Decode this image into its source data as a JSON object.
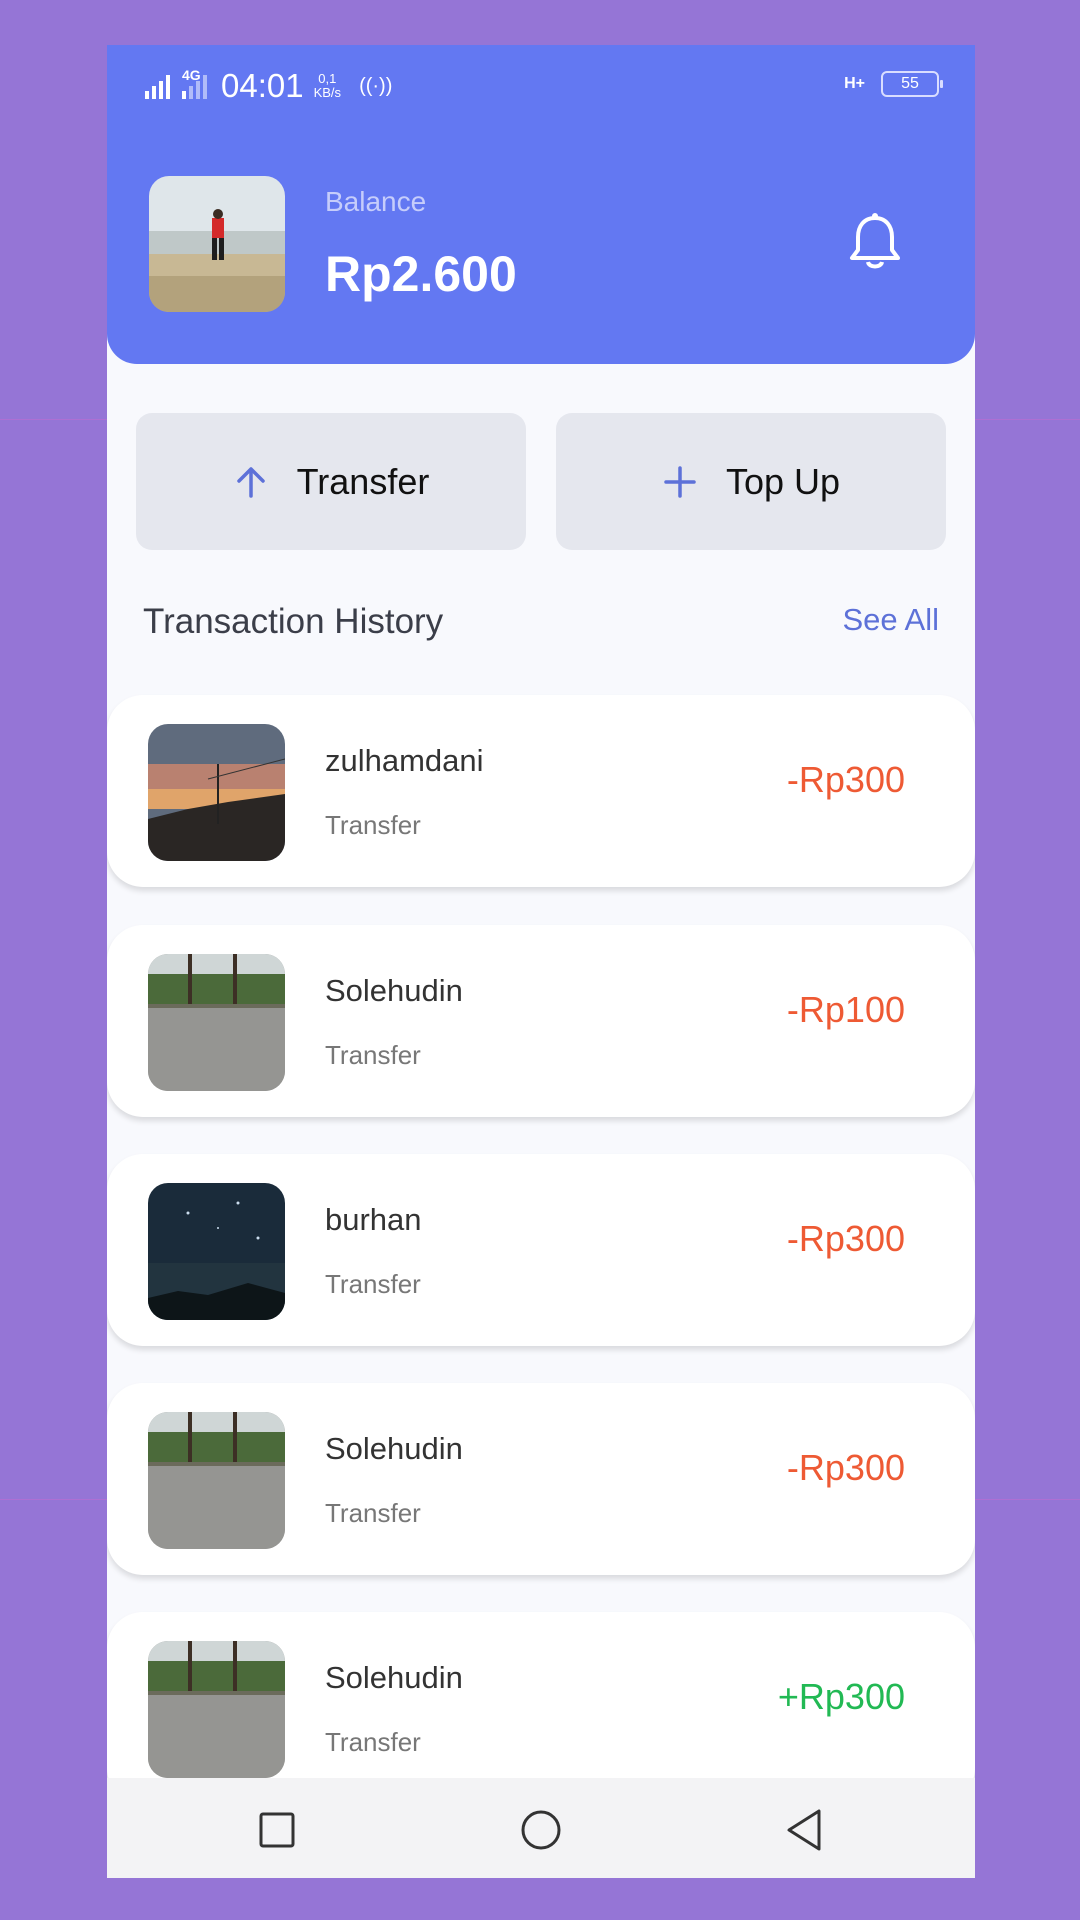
{
  "status_bar": {
    "network_left": "4G",
    "time": "04:01",
    "speed_value": "0,1",
    "speed_unit": "KB/s",
    "network_right": "H+",
    "battery": "55"
  },
  "header": {
    "balance_label": "Balance",
    "balance_value": "Rp2.600",
    "bell_icon": "bell-icon"
  },
  "actions": {
    "transfer_label": "Transfer",
    "topup_label": "Top Up"
  },
  "history": {
    "title": "Transaction History",
    "see_all": "See All",
    "items": [
      {
        "name": "zulhamdani",
        "type": "Transfer",
        "amount": "-Rp300"
      },
      {
        "name": "Solehudin",
        "type": "Transfer",
        "amount": "-Rp100"
      },
      {
        "name": "burhan",
        "type": "Transfer",
        "amount": "-Rp300"
      },
      {
        "name": "Solehudin",
        "type": "Transfer",
        "amount": "-Rp300"
      },
      {
        "name": "Solehudin",
        "type": "Transfer",
        "amount": "+Rp300"
      }
    ]
  },
  "colors": {
    "header": "#6378f2",
    "accent": "#5d71d8",
    "negative": "#ee5a34",
    "positive": "#22b954"
  }
}
